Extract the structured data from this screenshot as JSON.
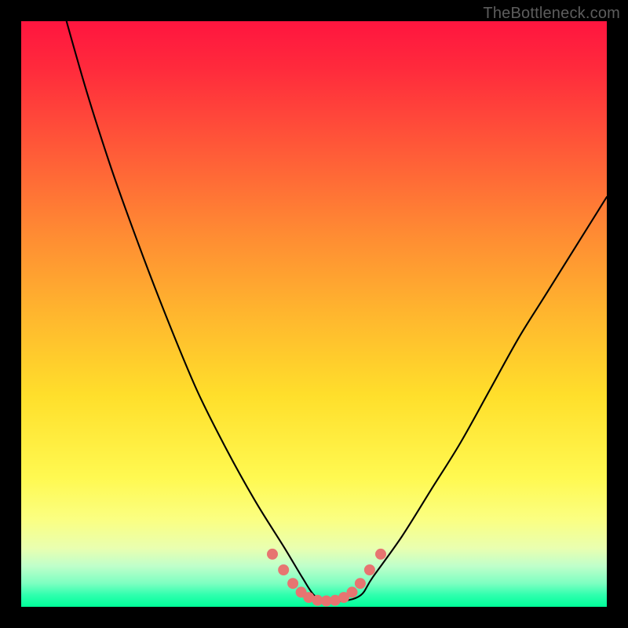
{
  "watermark": "TheBottleneck.com",
  "colors": {
    "background": "#000000",
    "marker": "#e77471",
    "curve": "#000000"
  },
  "chart_data": {
    "type": "line",
    "title": "",
    "xlabel": "",
    "ylabel": "",
    "xlim": [
      0,
      100
    ],
    "ylim": [
      0,
      100
    ],
    "grid": false,
    "note": "Axes unlabeled in source image. x is normalized position across the plot (0=left, 100=right). y is bottleneck magnitude (0=none/green, 100=severe/red). Curve shape estimated from pixels.",
    "series": [
      {
        "name": "bottleneck-curve",
        "x": [
          0,
          5,
          10,
          15,
          20,
          25,
          30,
          35,
          40,
          45,
          48,
          50,
          52,
          55,
          58,
          60,
          65,
          70,
          75,
          80,
          85,
          90,
          100
        ],
        "y": [
          137,
          111,
          92,
          76,
          62,
          49,
          37,
          27,
          18,
          10,
          5,
          2,
          1,
          1,
          2,
          5,
          12,
          20,
          28,
          37,
          46,
          54,
          70
        ]
      }
    ],
    "markers": {
      "name": "highlight-dots",
      "points_xy": [
        [
          42.9,
          9.0
        ],
        [
          44.8,
          6.3
        ],
        [
          46.4,
          4.0
        ],
        [
          47.8,
          2.5
        ],
        [
          49.1,
          1.6
        ],
        [
          50.6,
          1.1
        ],
        [
          52.1,
          1.0
        ],
        [
          53.6,
          1.1
        ],
        [
          55.1,
          1.6
        ],
        [
          56.5,
          2.5
        ],
        [
          57.9,
          4.0
        ],
        [
          59.5,
          6.3
        ],
        [
          61.4,
          9.0
        ]
      ],
      "radius_px": 7
    }
  }
}
